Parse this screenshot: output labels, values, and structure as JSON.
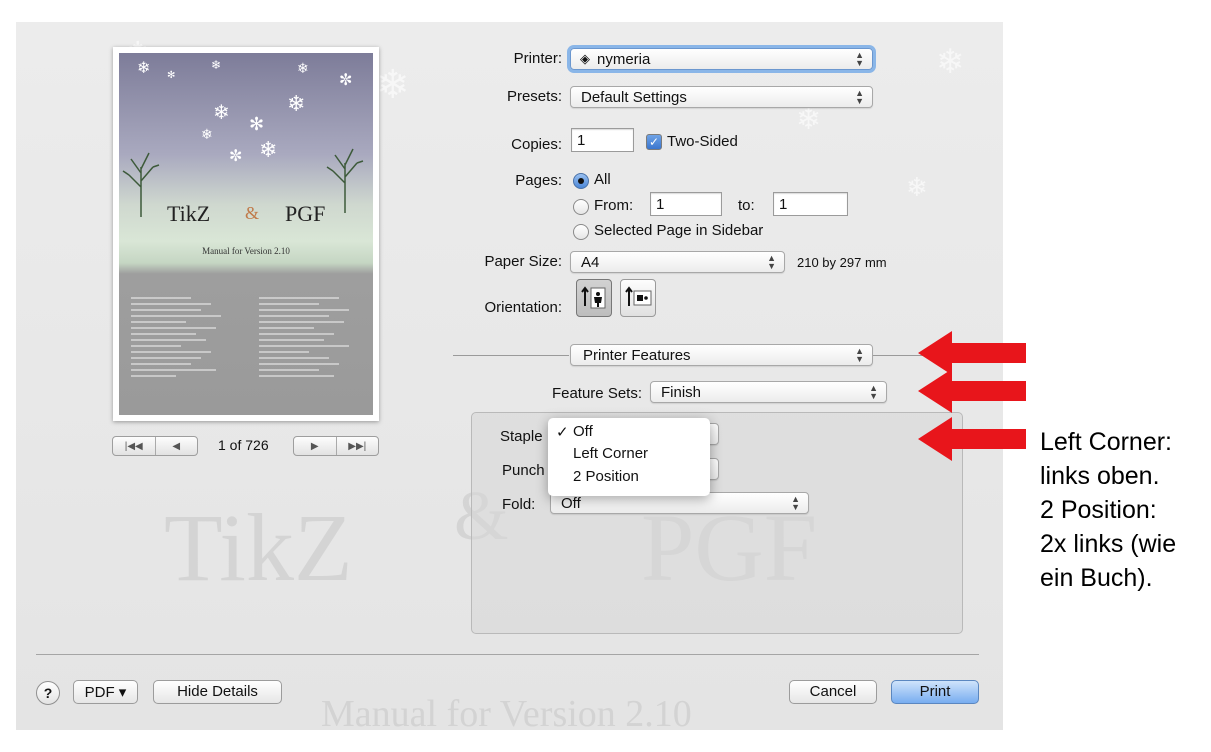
{
  "background": {
    "tikz": "TikZ",
    "pgf": "PGF",
    "amp": "&",
    "manual": "Manual for Version 2.10"
  },
  "preview": {
    "cover_title_left": "TikZ",
    "cover_amp": "&",
    "cover_title_right": "PGF",
    "cover_subtitle": "Manual for Version 2.10",
    "page_indicator": "1 of 726",
    "nav_first_icon": "first-page-icon",
    "nav_prev_icon": "previous-page-icon",
    "nav_next_icon": "next-page-icon",
    "nav_last_icon": "last-page-icon"
  },
  "printer": {
    "label": "Printer:",
    "value": "nymeria",
    "icon": "printer-network-icon"
  },
  "presets": {
    "label": "Presets:",
    "value": "Default Settings"
  },
  "copies": {
    "label": "Copies:",
    "value": "1",
    "two_sided_label": "Two-Sided",
    "two_sided_checked": true
  },
  "pages": {
    "label": "Pages:",
    "all_label": "All",
    "from_label": "From:",
    "from_value": "1",
    "to_label": "to:",
    "to_value": "1",
    "sidebar_label": "Selected Page in Sidebar",
    "selected": "All"
  },
  "paper_size": {
    "label": "Paper Size:",
    "value": "A4",
    "dimensions": "210 by 297 mm"
  },
  "orientation": {
    "label": "Orientation:",
    "options": [
      "portrait-icon",
      "landscape-icon"
    ],
    "selected": "portrait"
  },
  "section_popup": {
    "value": "Printer Features"
  },
  "feature_sets": {
    "label": "Feature Sets:",
    "value": "Finish"
  },
  "finish": {
    "staple_label": "Staple",
    "punch_label": "Punch",
    "fold_label": "Fold:",
    "fold_value": "Off"
  },
  "staple_menu": {
    "items": [
      {
        "label": "Off",
        "checked": true
      },
      {
        "label": "Left Corner",
        "checked": false
      },
      {
        "label": "2 Position",
        "checked": false
      }
    ],
    "check_glyph": "✓"
  },
  "footer": {
    "help_label": "?",
    "pdf_label": "PDF ▾",
    "hide_details_label": "Hide Details",
    "cancel_label": "Cancel",
    "print_label": "Print"
  },
  "annotation": {
    "lines": [
      "Left Corner:",
      "links oben.",
      "2 Position:",
      "2x links (wie",
      "ein Buch)."
    ],
    "arrow_color": "#e8151b"
  },
  "colors": {
    "accent": "#4b87d8",
    "focus_ring": "#8ab6e8",
    "arrow": "#e8151b"
  }
}
